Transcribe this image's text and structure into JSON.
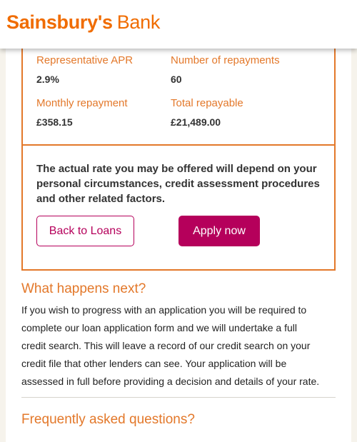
{
  "header": {
    "logo_brand": "Sainsbury's",
    "logo_sub": "Bank",
    "brand_color": "#f06c00"
  },
  "loan_summary": {
    "representative_apr_label": "Representative APR",
    "representative_apr_value": "2.9%",
    "number_of_repayments_label": "Number of repayments",
    "number_of_repayments_value": "60",
    "monthly_repayment_label": "Monthly repayment",
    "monthly_repayment_value": "£358.15",
    "total_repayable_label": "Total repayable",
    "total_repayable_value": "£21,489.00",
    "disclaimer": "The actual rate you may be offered will depend on your personal circumstances, credit assessment procedures and other related factors."
  },
  "actions": {
    "back_label": "Back to Loans",
    "apply_label": "Apply now",
    "accent_color": "#b5005b"
  },
  "next_steps": {
    "heading": "What happens next?",
    "body": "If you wish to progress with an application you will be required to complete our loan application form and we will undertake a full credit search. This will leave a record of our credit search on your credit file that other lenders can see. Your application will be assessed in full before providing a decision and details of your rate."
  },
  "faq": {
    "heading": "Frequently asked questions?"
  }
}
